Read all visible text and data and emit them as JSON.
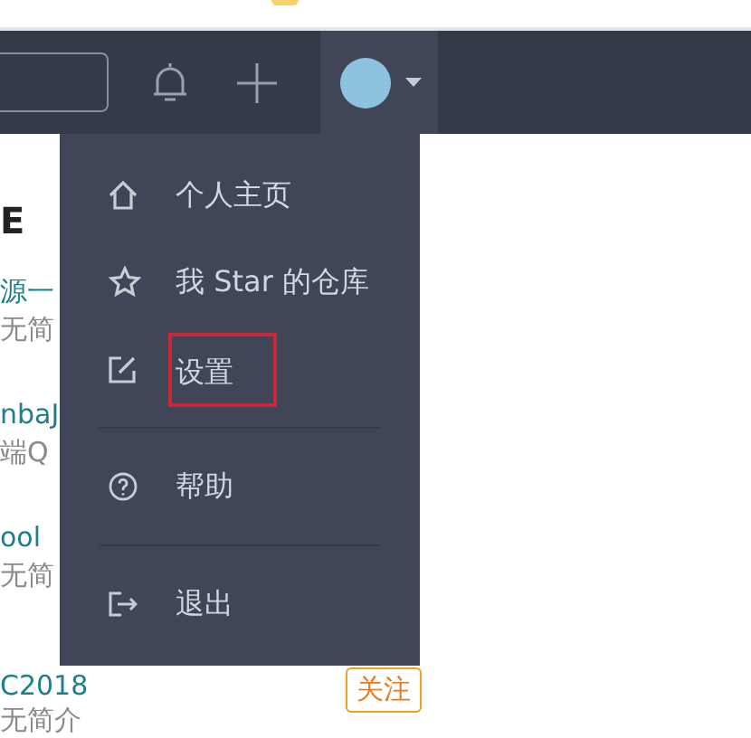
{
  "header": {
    "user_menu_open": true
  },
  "heading": "E",
  "repos": [
    {
      "name": "源一",
      "description": "无简"
    },
    {
      "name": "nbaJ",
      "description": "端Q"
    },
    {
      "name": "ool",
      "description": "无简"
    },
    {
      "name": "C2018",
      "description": "无简介",
      "follow_button": "关注"
    }
  ],
  "menu": {
    "sections": [
      {
        "items": [
          {
            "kind": "home",
            "label": "个人主页",
            "highlighted": false
          },
          {
            "kind": "star",
            "label": "我 Star 的仓库",
            "highlighted": false
          },
          {
            "kind": "edit",
            "label": "设置",
            "highlighted": true
          }
        ]
      },
      {
        "items": [
          {
            "kind": "help",
            "label": "帮助",
            "highlighted": false
          }
        ]
      },
      {
        "items": [
          {
            "kind": "logout",
            "label": "退出",
            "highlighted": false
          }
        ]
      }
    ]
  }
}
